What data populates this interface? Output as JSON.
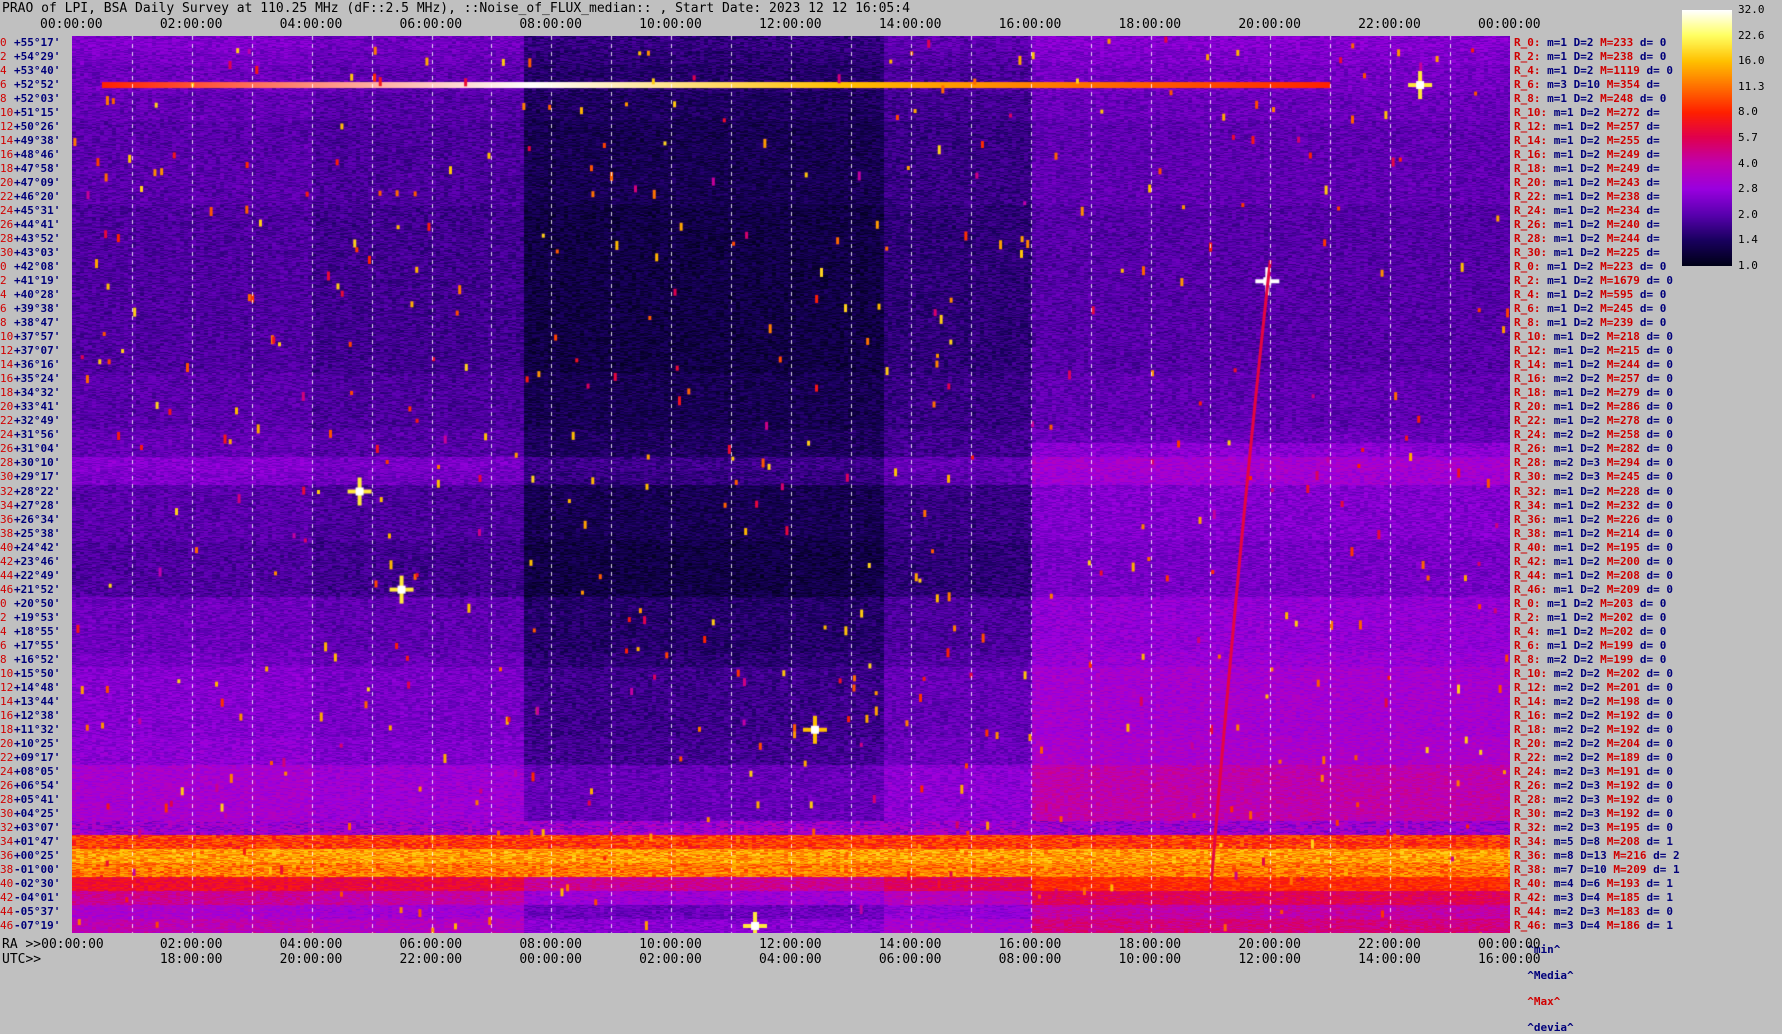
{
  "title": "PRAO of LPI, BSA Daily Survey at 110.25 MHz (dF::2.5 MHz), ::Noise_of_FLUX_median:: , Start Date: 2023 12 12 16:05:4",
  "ra_label": "RA >>00:00:00",
  "utc_label": "UTC>>",
  "chart_data": {
    "type": "heatmap",
    "title": "PRAO of LPI, BSA Daily Survey at 110.25 MHz (dF::2.5 MHz), ::Noise_of_FLUX_median:: , Start Date: 2023 12 12 16:05:4",
    "x_top_ticks": [
      "00:00:00",
      "02:00:00",
      "04:00:00",
      "06:00:00",
      "08:00:00",
      "10:00:00",
      "12:00:00",
      "14:00:00",
      "16:00:00",
      "18:00:00",
      "20:00:00",
      "22:00:00",
      "00:00:00"
    ],
    "x_bottom_ra_ticks": [
      "00:00:00",
      "02:00:00",
      "04:00:00",
      "06:00:00",
      "08:00:00",
      "10:00:00",
      "12:00:00",
      "14:00:00",
      "16:00:00",
      "18:00:00",
      "20:00:00",
      "22:00:00",
      "00:00:00"
    ],
    "x_bottom_utc_ticks": [
      "18:00:00",
      "20:00:00",
      "22:00:00",
      "00:00:00",
      "02:00:00",
      "04:00:00",
      "06:00:00",
      "08:00:00",
      "10:00:00",
      "12:00:00",
      "14:00:00",
      "16:00:00"
    ],
    "x_range_hours": [
      0,
      24
    ],
    "colorbar": {
      "ticks": [
        "32.0",
        "22.6",
        "16.0",
        "11.3",
        "8.0",
        "5.7",
        "4.0",
        "2.8",
        "2.0",
        "1.4",
        "1.0"
      ],
      "range": [
        1.0,
        32.0
      ],
      "scale": "log",
      "colormap": [
        "#000018",
        "#1a0060",
        "#5a00b0",
        "#9a00e0",
        "#c000b0",
        "#e00050",
        "#ff2000",
        "#ff7000",
        "#ffc000",
        "#ffff60",
        "#ffffff"
      ]
    },
    "rows": [
      {
        "idx": "0",
        "dec": "+55°17'",
        "stat": "R_0:",
        "m": "m=1",
        "d": "D=2",
        "h": "M=233",
        "dv": "d= 0",
        "base": 2.2
      },
      {
        "idx": "2",
        "dec": "+54°29'",
        "stat": "R_2:",
        "m": "m=1",
        "d": "D=2",
        "h": "M=238",
        "dv": "d= 0",
        "base": 2.1
      },
      {
        "idx": "4",
        "dec": "+53°40'",
        "stat": "R_4:",
        "m": "m=1",
        "d": "D=2",
        "h": "M=1119",
        "dv": "d= 0",
        "base": 2.0
      },
      {
        "idx": "6",
        "dec": "+52°52'",
        "stat": "R_6:",
        "m": "m=3",
        "d": "D=10",
        "h": "M=354",
        "dv": "d=",
        "base": 2.0
      },
      {
        "idx": "8",
        "dec": "+52°03'",
        "stat": "R_8:",
        "m": "m=1",
        "d": "D=2",
        "h": "M=248",
        "dv": "d= 0",
        "base": 1.9
      },
      {
        "idx": "10",
        "dec": "+51°15'",
        "stat": "R_10:",
        "m": "m=1",
        "d": "D=2",
        "h": "M=272",
        "dv": "d=",
        "base": 1.9
      },
      {
        "idx": "12",
        "dec": "+50°26'",
        "stat": "R_12:",
        "m": "m=1",
        "d": "D=2",
        "h": "M=257",
        "dv": "d=",
        "base": 1.8
      },
      {
        "idx": "14",
        "dec": "+49°38'",
        "stat": "R_14:",
        "m": "m=1",
        "d": "D=2",
        "h": "M=255",
        "dv": "d=",
        "base": 1.8
      },
      {
        "idx": "16",
        "dec": "+48°46'",
        "stat": "R_16:",
        "m": "m=1",
        "d": "D=2",
        "h": "M=249",
        "dv": "d=",
        "base": 1.8
      },
      {
        "idx": "18",
        "dec": "+47°58'",
        "stat": "R_18:",
        "m": "m=1",
        "d": "D=2",
        "h": "M=249",
        "dv": "d=",
        "base": 1.8
      },
      {
        "idx": "20",
        "dec": "+47°09'",
        "stat": "R_20:",
        "m": "m=1",
        "d": "D=2",
        "h": "M=243",
        "dv": "d=",
        "base": 1.8
      },
      {
        "idx": "22",
        "dec": "+46°20'",
        "stat": "R_22:",
        "m": "m=1",
        "d": "D=2",
        "h": "M=238",
        "dv": "d=",
        "base": 1.8
      },
      {
        "idx": "24",
        "dec": "+45°31'",
        "stat": "R_24:",
        "m": "m=1",
        "d": "D=2",
        "h": "M=234",
        "dv": "d=",
        "base": 1.7
      },
      {
        "idx": "26",
        "dec": "+44°41'",
        "stat": "R_26:",
        "m": "m=1",
        "d": "D=2",
        "h": "M=240",
        "dv": "d=",
        "base": 1.7
      },
      {
        "idx": "28",
        "dec": "+43°52'",
        "stat": "R_28:",
        "m": "m=1",
        "d": "D=2",
        "h": "M=244",
        "dv": "d=",
        "base": 1.7
      },
      {
        "idx": "30",
        "dec": "+43°03'",
        "stat": "R_30:",
        "m": "m=1",
        "d": "D=2",
        "h": "M=225",
        "dv": "d=",
        "base": 1.7
      },
      {
        "idx": "0",
        "dec": "+42°08'",
        "stat": "R_0:",
        "m": "m=1",
        "d": "D=2",
        "h": "M=223",
        "dv": "d= 0",
        "base": 1.7
      },
      {
        "idx": "2",
        "dec": "+41°19'",
        "stat": "R_2:",
        "m": "m=1",
        "d": "D=2",
        "h": "M=1679",
        "dv": "d= 0",
        "base": 1.7
      },
      {
        "idx": "4",
        "dec": "+40°28'",
        "stat": "R_4:",
        "m": "m=1",
        "d": "D=2",
        "h": "M=595",
        "dv": "d= 0",
        "base": 1.7
      },
      {
        "idx": "6",
        "dec": "+39°38'",
        "stat": "R_6:",
        "m": "m=1",
        "d": "D=2",
        "h": "M=245",
        "dv": "d= 0",
        "base": 1.7
      },
      {
        "idx": "8",
        "dec": "+38°47'",
        "stat": "R_8:",
        "m": "m=1",
        "d": "D=2",
        "h": "M=239",
        "dv": "d= 0",
        "base": 1.7
      },
      {
        "idx": "10",
        "dec": "+37°57'",
        "stat": "R_10:",
        "m": "m=1",
        "d": "D=2",
        "h": "M=218",
        "dv": "d= 0",
        "base": 1.7
      },
      {
        "idx": "12",
        "dec": "+37°07'",
        "stat": "R_12:",
        "m": "m=1",
        "d": "D=2",
        "h": "M=215",
        "dv": "d= 0",
        "base": 1.7
      },
      {
        "idx": "14",
        "dec": "+36°16'",
        "stat": "R_14:",
        "m": "m=1",
        "d": "D=2",
        "h": "M=244",
        "dv": "d= 0",
        "base": 1.7
      },
      {
        "idx": "16",
        "dec": "+35°24'",
        "stat": "R_16:",
        "m": "m=2",
        "d": "D=2",
        "h": "M=257",
        "dv": "d= 0",
        "base": 1.8
      },
      {
        "idx": "18",
        "dec": "+34°32'",
        "stat": "R_18:",
        "m": "m=1",
        "d": "D=2",
        "h": "M=279",
        "dv": "d= 0",
        "base": 1.8
      },
      {
        "idx": "20",
        "dec": "+33°41'",
        "stat": "R_20:",
        "m": "m=1",
        "d": "D=2",
        "h": "M=286",
        "dv": "d= 0",
        "base": 1.8
      },
      {
        "idx": "22",
        "dec": "+32°49'",
        "stat": "R_22:",
        "m": "m=1",
        "d": "D=2",
        "h": "M=278",
        "dv": "d= 0",
        "base": 1.8
      },
      {
        "idx": "24",
        "dec": "+31°56'",
        "stat": "R_24:",
        "m": "m=2",
        "d": "D=2",
        "h": "M=258",
        "dv": "d= 0",
        "base": 1.9
      },
      {
        "idx": "26",
        "dec": "+31°04'",
        "stat": "R_26:",
        "m": "m=1",
        "d": "D=2",
        "h": "M=282",
        "dv": "d= 0",
        "base": 1.9
      },
      {
        "idx": "28",
        "dec": "+30°10'",
        "stat": "R_28:",
        "m": "m=2",
        "d": "D=3",
        "h": "M=294",
        "dv": "d= 0",
        "base": 2.3
      },
      {
        "idx": "30",
        "dec": "+29°17'",
        "stat": "R_30:",
        "m": "m=2",
        "d": "D=3",
        "h": "M=245",
        "dv": "d= 0",
        "base": 2.2
      },
      {
        "idx": "32",
        "dec": "+28°22'",
        "stat": "R_32:",
        "m": "m=1",
        "d": "D=2",
        "h": "M=228",
        "dv": "d= 0",
        "base": 1.8
      },
      {
        "idx": "34",
        "dec": "+27°28'",
        "stat": "R_34:",
        "m": "m=1",
        "d": "D=2",
        "h": "M=232",
        "dv": "d= 0",
        "base": 1.8
      },
      {
        "idx": "36",
        "dec": "+26°34'",
        "stat": "R_36:",
        "m": "m=1",
        "d": "D=2",
        "h": "M=226",
        "dv": "d= 0",
        "base": 1.8
      },
      {
        "idx": "38",
        "dec": "+25°38'",
        "stat": "R_38:",
        "m": "m=1",
        "d": "D=2",
        "h": "M=214",
        "dv": "d= 0",
        "base": 1.8
      },
      {
        "idx": "40",
        "dec": "+24°42'",
        "stat": "R_40:",
        "m": "m=1",
        "d": "D=2",
        "h": "M=195",
        "dv": "d= 0",
        "base": 1.7
      },
      {
        "idx": "42",
        "dec": "+23°46'",
        "stat": "R_42:",
        "m": "m=1",
        "d": "D=2",
        "h": "M=200",
        "dv": "d= 0",
        "base": 1.7
      },
      {
        "idx": "44",
        "dec": "+22°49'",
        "stat": "R_44:",
        "m": "m=1",
        "d": "D=2",
        "h": "M=208",
        "dv": "d= 0",
        "base": 1.7
      },
      {
        "idx": "46",
        "dec": "+21°52'",
        "stat": "R_46:",
        "m": "m=1",
        "d": "D=2",
        "h": "M=209",
        "dv": "d= 0",
        "base": 1.7
      },
      {
        "idx": "0",
        "dec": "+20°50'",
        "stat": "R_0:",
        "m": "m=1",
        "d": "D=2",
        "h": "M=203",
        "dv": "d= 0",
        "base": 2.0
      },
      {
        "idx": "2",
        "dec": "+19°53'",
        "stat": "R_2:",
        "m": "m=1",
        "d": "D=2",
        "h": "M=202",
        "dv": "d= 0",
        "base": 2.0
      },
      {
        "idx": "4",
        "dec": "+18°55'",
        "stat": "R_4:",
        "m": "m=1",
        "d": "D=2",
        "h": "M=202",
        "dv": "d= 0",
        "base": 2.0
      },
      {
        "idx": "6",
        "dec": "+17°55'",
        "stat": "R_6:",
        "m": "m=1",
        "d": "D=2",
        "h": "M=199",
        "dv": "d= 0",
        "base": 2.0
      },
      {
        "idx": "8",
        "dec": "+16°52'",
        "stat": "R_8:",
        "m": "m=2",
        "d": "D=2",
        "h": "M=199",
        "dv": "d= 0",
        "base": 2.1
      },
      {
        "idx": "10",
        "dec": "+15°50'",
        "stat": "R_10:",
        "m": "m=2",
        "d": "D=2",
        "h": "M=202",
        "dv": "d= 0",
        "base": 2.3
      },
      {
        "idx": "12",
        "dec": "+14°48'",
        "stat": "R_12:",
        "m": "m=2",
        "d": "D=2",
        "h": "M=201",
        "dv": "d= 0",
        "base": 2.3
      },
      {
        "idx": "14",
        "dec": "+13°44'",
        "stat": "R_14:",
        "m": "m=2",
        "d": "D=2",
        "h": "M=198",
        "dv": "d= 0",
        "base": 2.3
      },
      {
        "idx": "16",
        "dec": "+12°38'",
        "stat": "R_16:",
        "m": "m=2",
        "d": "D=2",
        "h": "M=192",
        "dv": "d= 0",
        "base": 2.3
      },
      {
        "idx": "18",
        "dec": "+11°32'",
        "stat": "R_18:",
        "m": "m=2",
        "d": "D=2",
        "h": "M=192",
        "dv": "d= 0",
        "base": 2.3
      },
      {
        "idx": "20",
        "dec": "+10°25'",
        "stat": "R_20:",
        "m": "m=2",
        "d": "D=2",
        "h": "M=204",
        "dv": "d= 0",
        "base": 2.4
      },
      {
        "idx": "22",
        "dec": "+09°17'",
        "stat": "R_22:",
        "m": "m=2",
        "d": "D=2",
        "h": "M=189",
        "dv": "d= 0",
        "base": 2.4
      },
      {
        "idx": "24",
        "dec": "+08°05'",
        "stat": "R_24:",
        "m": "m=2",
        "d": "D=3",
        "h": "M=191",
        "dv": "d= 0",
        "base": 2.9
      },
      {
        "idx": "26",
        "dec": "+06°54'",
        "stat": "R_26:",
        "m": "m=2",
        "d": "D=3",
        "h": "M=192",
        "dv": "d= 0",
        "base": 2.9
      },
      {
        "idx": "28",
        "dec": "+05°41'",
        "stat": "R_28:",
        "m": "m=2",
        "d": "D=3",
        "h": "M=192",
        "dv": "d= 0",
        "base": 2.9
      },
      {
        "idx": "30",
        "dec": "+04°25'",
        "stat": "R_30:",
        "m": "m=2",
        "d": "D=3",
        "h": "M=192",
        "dv": "d= 0",
        "base": 2.9
      },
      {
        "idx": "32",
        "dec": "+03°07'",
        "stat": "R_32:",
        "m": "m=2",
        "d": "D=3",
        "h": "M=195",
        "dv": "d= 0",
        "base": 3.0
      },
      {
        "idx": "34",
        "dec": "+01°47'",
        "stat": "R_34:",
        "m": "m=5",
        "d": "D=8",
        "h": "M=208",
        "dv": "d= 1",
        "base": 9.0
      },
      {
        "idx": "36",
        "dec": "+00°25'",
        "stat": "R_36:",
        "m": "m=8",
        "d": "D=13",
        "h": "M=216",
        "dv": "d= 2",
        "base": 14.0
      },
      {
        "idx": "38",
        "dec": "-01°00'",
        "stat": "R_38:",
        "m": "m=7",
        "d": "D=10",
        "h": "M=209",
        "dv": "d= 1",
        "base": 12.0
      },
      {
        "idx": "40",
        "dec": "-02°30'",
        "stat": "R_40:",
        "m": "m=4",
        "d": "D=6",
        "h": "M=193",
        "dv": "d= 1",
        "base": 6.0
      },
      {
        "idx": "42",
        "dec": "-04°01'",
        "stat": "R_42:",
        "m": "m=3",
        "d": "D=4",
        "h": "M=185",
        "dv": "d= 1",
        "base": 4.0
      },
      {
        "idx": "44",
        "dec": "-05°37'",
        "stat": "R_44:",
        "m": "m=2",
        "d": "D=3",
        "h": "M=183",
        "dv": "d= 0",
        "base": 3.0
      },
      {
        "idx": "46",
        "dec": "-07°19'",
        "stat": "R_46:",
        "m": "m=3",
        "d": "D=4",
        "h": "M=186",
        "dv": "d= 1",
        "base": 3.5
      }
    ],
    "features": [
      {
        "kind": "hband",
        "dec_row": 3,
        "x_start": 0.5,
        "x_end": 21.0,
        "value": 16.0
      },
      {
        "kind": "source",
        "dec_row": 17,
        "x": 19.95,
        "value": 32.0
      },
      {
        "kind": "source",
        "dec_row": 3,
        "x": 22.5,
        "value": 20.0
      },
      {
        "kind": "source",
        "dec_row": 32,
        "x": 4.8,
        "value": 20.0
      },
      {
        "kind": "source",
        "dec_row": 39,
        "x": 5.5,
        "value": 20.0
      },
      {
        "kind": "source",
        "dec_row": 49,
        "x": 12.4,
        "value": 16.0
      },
      {
        "kind": "source",
        "dec_row": 63,
        "x": 11.4,
        "value": 20.0
      },
      {
        "kind": "arc",
        "x_start": 19.0,
        "x_end": 20.0,
        "value": 6.0
      }
    ]
  },
  "legend": {
    "min": "^min^",
    "med": "^Media^",
    "max": "^Max^",
    "dev": "^devia^"
  }
}
